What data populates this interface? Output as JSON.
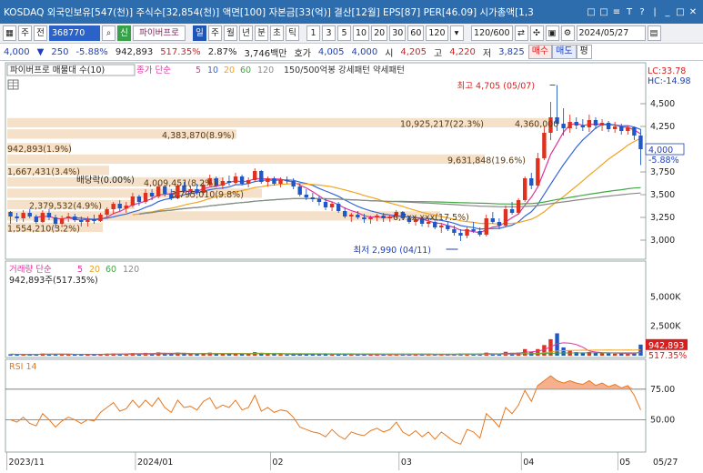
{
  "title_bar": {
    "text": "KOSDAQ 외국인보유[547(천)] 주식수[32,854(천)] 액면[100] 자본금[33(억)] 결산[12월] EPS[87] PER[46.09] 시가총액[1,3",
    "window_buttons": [
      "□",
      "□",
      "≡",
      "T",
      "?",
      "|",
      "_",
      "□",
      "✕"
    ]
  },
  "toolbar": {
    "mode": "주",
    "period": "전",
    "code": "368770",
    "name": "파이버프로",
    "day": "일",
    "intervals": [
      "일",
      "주",
      "월",
      "년",
      "분",
      "초",
      "틱"
    ],
    "minute_opts": [
      "1",
      "3",
      "5",
      "10",
      "20",
      "30",
      "60",
      "120"
    ],
    "count": "120/600",
    "date": "2024/05/27"
  },
  "quote": {
    "price": "4,000",
    "change": "250",
    "change_pct": "-5.88%",
    "volume": "942,893",
    "vol_rate": "517.35%",
    "turnover": "2.87%",
    "amount": "3,746백만",
    "hoga_label": "호가",
    "ask": "4,005",
    "bid": "4,000",
    "high_label": "시",
    "high": "4,205",
    "open_label": "고",
    "open": "4,220",
    "low_label": "저",
    "low": "3,825",
    "buy": "매수",
    "sell": "매도",
    "eval": "평"
  },
  "price_panel": {
    "legend_title": "파이버프로 매물대 수(10)",
    "legend_ma": "종가 단순",
    "ma_periods": [
      "5",
      "10",
      "20",
      "60",
      "120"
    ],
    "legend_extra": "150/500억봉 강세패턴  약세패턴",
    "lc": "LC:33.78",
    "hc": "HC:-14.98",
    "max_label": "최고 4,705 (05/07)",
    "min_label": "최저 2,990 (04/11)",
    "dividend_label": "배당락(0.00%)",
    "current": "4,000",
    "current_pct": "-5.88%",
    "axis": [
      "4,500",
      "4,250",
      "3,750",
      "3,500",
      "3,250",
      "3,000"
    ],
    "volume_profile": [
      {
        "label": "10,925,217(22.3%)",
        "price": 4280,
        "w": 0.85
      },
      {
        "label": "4,383,870(8.9%)",
        "price": 4155,
        "w": 0.36
      },
      {
        "label": "942,893(1.9%)",
        "price": 4005,
        "w": 0.1
      },
      {
        "label": "9,631,848(19.6%)",
        "price": 3880,
        "w": 0.75
      },
      {
        "label": "1,667,431(3.4%)",
        "price": 3755,
        "w": 0.16
      },
      {
        "label": "4,009,451(8.2%)",
        "price": 3630,
        "w": 0.34
      },
      {
        "label": "3,795,010(9.8%)",
        "price": 3505,
        "w": 0.4
      },
      {
        "label": "2,379,532(4.9%)",
        "price": 3380,
        "w": 0.2
      },
      {
        "label": "6,7xx,xxx(17.5%)",
        "price": 3255,
        "w": 0.68
      },
      {
        "label": "1,554,210(3.2%)",
        "price": 3130,
        "w": 0.15
      }
    ],
    "vp_extra_label": "4,360,000"
  },
  "volume_panel": {
    "legend": "거래량 단순",
    "ma_periods": [
      "5",
      "20",
      "60",
      "120"
    ],
    "value_label": "942,893주(517.35%)",
    "axis": [
      "5,000K",
      "2,500K"
    ],
    "current": "942,893",
    "current_pct": "517.35%"
  },
  "rsi_panel": {
    "legend": "RSI 14",
    "axis": [
      "75.00",
      "50.00"
    ]
  },
  "date_axis": [
    "2023/11",
    "2024/01",
    "02",
    "03",
    "04",
    "05",
    "05/27"
  ],
  "colors": {
    "up": "#e0301e",
    "down": "#1f57c7",
    "ma5": "#e0359c",
    "ma10": "#3567d8",
    "ma20": "#f2a31f",
    "ma60": "#42a844",
    "ma120": "#8a8a8a",
    "vp": "#f3dcc0",
    "rsi": "#e8781f"
  },
  "chart_data": {
    "type": "candlestick",
    "candles": [
      [
        3310,
        3320,
        3180,
        3260,
        120
      ],
      [
        3260,
        3300,
        3200,
        3240,
        110
      ],
      [
        3240,
        3330,
        3200,
        3300,
        105
      ],
      [
        3300,
        3340,
        3240,
        3260,
        100
      ],
      [
        3260,
        3280,
        3180,
        3200,
        115
      ],
      [
        3200,
        3330,
        3190,
        3300,
        180
      ],
      [
        3300,
        3340,
        3220,
        3250,
        120
      ],
      [
        3250,
        3280,
        3130,
        3180,
        150
      ],
      [
        3180,
        3270,
        3140,
        3240,
        110
      ],
      [
        3240,
        3300,
        3200,
        3260,
        100
      ],
      [
        3260,
        3290,
        3200,
        3220,
        95
      ],
      [
        3220,
        3260,
        3150,
        3200,
        120
      ],
      [
        3200,
        3260,
        3150,
        3230,
        100
      ],
      [
        3230,
        3280,
        3180,
        3210,
        95
      ],
      [
        3210,
        3300,
        3200,
        3280,
        140
      ],
      [
        3280,
        3360,
        3260,
        3340,
        170
      ],
      [
        3340,
        3420,
        3290,
        3400,
        190
      ],
      [
        3400,
        3440,
        3320,
        3350,
        150
      ],
      [
        3350,
        3420,
        3300,
        3380,
        130
      ],
      [
        3380,
        3520,
        3360,
        3480,
        220
      ],
      [
        3480,
        3500,
        3380,
        3420,
        180
      ],
      [
        3420,
        3560,
        3400,
        3520,
        240
      ],
      [
        3520,
        3560,
        3440,
        3480,
        160
      ],
      [
        3480,
        3620,
        3460,
        3590,
        280
      ],
      [
        3590,
        3600,
        3480,
        3510,
        190
      ],
      [
        3510,
        3560,
        3440,
        3460,
        150
      ],
      [
        3460,
        3620,
        3450,
        3600,
        260
      ],
      [
        3600,
        3640,
        3520,
        3540,
        180
      ],
      [
        3540,
        3600,
        3480,
        3560,
        140
      ],
      [
        3560,
        3620,
        3500,
        3520,
        130
      ],
      [
        3520,
        3650,
        3500,
        3610,
        220
      ],
      [
        3610,
        3720,
        3590,
        3680,
        260
      ],
      [
        3680,
        3700,
        3580,
        3600,
        170
      ],
      [
        3600,
        3690,
        3560,
        3650,
        150
      ],
      [
        3650,
        3710,
        3600,
        3630,
        140
      ],
      [
        3630,
        3740,
        3610,
        3700,
        230
      ],
      [
        3700,
        3720,
        3600,
        3620,
        160
      ],
      [
        3620,
        3690,
        3580,
        3660,
        130
      ],
      [
        3660,
        3790,
        3640,
        3760,
        300
      ],
      [
        3760,
        3770,
        3620,
        3640,
        210
      ],
      [
        3640,
        3700,
        3590,
        3680,
        140
      ],
      [
        3680,
        3700,
        3600,
        3620,
        120
      ],
      [
        3620,
        3690,
        3580,
        3660,
        110
      ],
      [
        3660,
        3700,
        3620,
        3650,
        100
      ],
      [
        3650,
        3680,
        3560,
        3590,
        120
      ],
      [
        3590,
        3620,
        3480,
        3500,
        150
      ],
      [
        3500,
        3560,
        3440,
        3470,
        140
      ],
      [
        3470,
        3520,
        3420,
        3450,
        120
      ],
      [
        3450,
        3490,
        3380,
        3420,
        110
      ],
      [
        3420,
        3460,
        3330,
        3360,
        130
      ],
      [
        3360,
        3420,
        3320,
        3400,
        100
      ],
      [
        3400,
        3420,
        3300,
        3320,
        110
      ],
      [
        3320,
        3360,
        3240,
        3260,
        140
      ],
      [
        3260,
        3300,
        3200,
        3280,
        100
      ],
      [
        3280,
        3320,
        3230,
        3250,
        95
      ],
      [
        3250,
        3290,
        3190,
        3230,
        100
      ],
      [
        3230,
        3270,
        3180,
        3250,
        90
      ],
      [
        3250,
        3290,
        3210,
        3270,
        85
      ],
      [
        3270,
        3300,
        3200,
        3240,
        95
      ],
      [
        3240,
        3280,
        3200,
        3260,
        80
      ],
      [
        3260,
        3330,
        3240,
        3310,
        110
      ],
      [
        3310,
        3320,
        3220,
        3240,
        100
      ],
      [
        3240,
        3270,
        3180,
        3200,
        95
      ],
      [
        3200,
        3260,
        3160,
        3230,
        90
      ],
      [
        3230,
        3250,
        3150,
        3180,
        100
      ],
      [
        3180,
        3240,
        3140,
        3200,
        90
      ],
      [
        3200,
        3230,
        3120,
        3140,
        110
      ],
      [
        3140,
        3190,
        3080,
        3160,
        95
      ],
      [
        3160,
        3200,
        3100,
        3120,
        100
      ],
      [
        3120,
        3160,
        3050,
        3080,
        120
      ],
      [
        3080,
        3120,
        2990,
        3050,
        180
      ],
      [
        3050,
        3150,
        3020,
        3120,
        160
      ],
      [
        3120,
        3200,
        3080,
        3100,
        130
      ],
      [
        3100,
        3140,
        3040,
        3060,
        110
      ],
      [
        3060,
        3280,
        3040,
        3240,
        260
      ],
      [
        3240,
        3310,
        3180,
        3200,
        170
      ],
      [
        3200,
        3240,
        3120,
        3160,
        120
      ],
      [
        3160,
        3380,
        3140,
        3340,
        330
      ],
      [
        3340,
        3420,
        3280,
        3300,
        200
      ],
      [
        3300,
        3460,
        3280,
        3440,
        260
      ],
      [
        3440,
        3700,
        3420,
        3680,
        560
      ],
      [
        3680,
        3740,
        3560,
        3600,
        300
      ],
      [
        3600,
        3960,
        3580,
        3900,
        560
      ],
      [
        3900,
        4250,
        3880,
        4180,
        900
      ],
      [
        4180,
        4520,
        4100,
        4350,
        1400
      ],
      [
        4350,
        4705,
        4200,
        4280,
        1900
      ],
      [
        4280,
        4450,
        4150,
        4230,
        700
      ],
      [
        4230,
        4380,
        4180,
        4300,
        420
      ],
      [
        4300,
        4350,
        4220,
        4260,
        300
      ],
      [
        4260,
        4330,
        4200,
        4240,
        260
      ],
      [
        4240,
        4380,
        4190,
        4320,
        310
      ],
      [
        4320,
        4350,
        4220,
        4260,
        240
      ],
      [
        4260,
        4330,
        4200,
        4290,
        200
      ],
      [
        4290,
        4310,
        4190,
        4220,
        190
      ],
      [
        4220,
        4300,
        4180,
        4250,
        170
      ],
      [
        4250,
        4280,
        4160,
        4200,
        180
      ],
      [
        4200,
        4260,
        4160,
        4240,
        150
      ],
      [
        4240,
        4250,
        4100,
        4150,
        190
      ],
      [
        4150,
        4220,
        3825,
        4000,
        943
      ]
    ],
    "rsi": [
      50,
      48,
      52,
      47,
      45,
      55,
      50,
      44,
      49,
      52,
      50,
      47,
      50,
      49,
      56,
      60,
      64,
      57,
      59,
      66,
      60,
      66,
      61,
      68,
      60,
      56,
      66,
      60,
      61,
      58,
      65,
      68,
      59,
      62,
      60,
      66,
      58,
      60,
      70,
      57,
      60,
      56,
      58,
      57,
      52,
      44,
      42,
      40,
      39,
      36,
      42,
      37,
      34,
      40,
      38,
      37,
      41,
      43,
      40,
      42,
      48,
      40,
      37,
      41,
      36,
      40,
      34,
      40,
      36,
      32,
      30,
      42,
      40,
      35,
      55,
      50,
      44,
      60,
      55,
      62,
      74,
      65,
      78,
      82,
      86,
      82,
      80,
      82,
      80,
      79,
      82,
      78,
      80,
      77,
      79,
      76,
      78,
      70,
      58
    ],
    "ylim": [
      2850,
      4750
    ],
    "rsi_ylim": [
      25,
      95
    ],
    "vol_max": 6500
  }
}
